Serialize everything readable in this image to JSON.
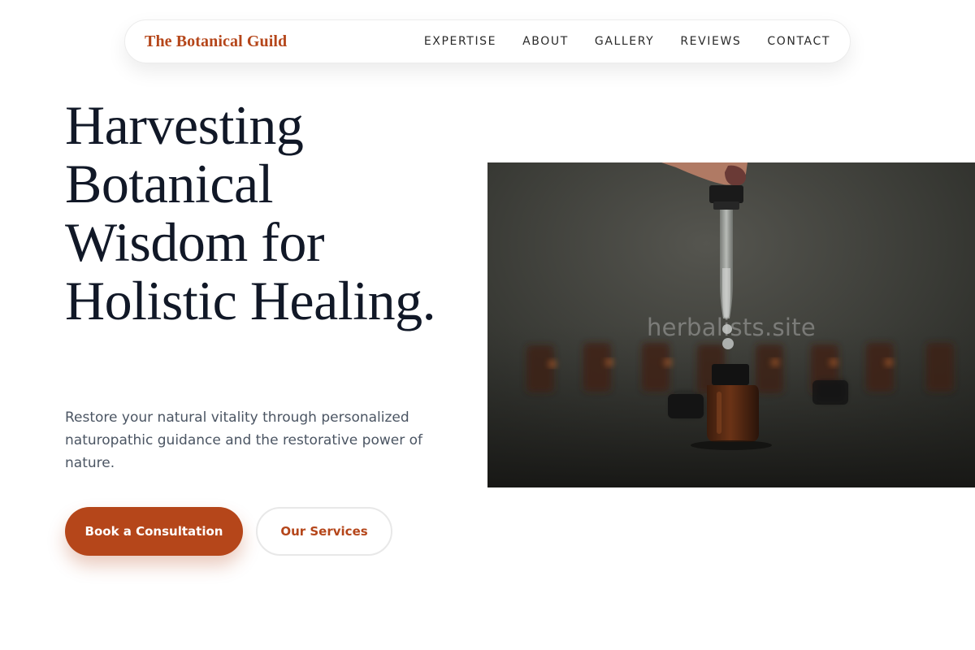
{
  "nav": {
    "brand": "The Botanical Guild",
    "links": [
      "EXPERTISE",
      "ABOUT",
      "GALLERY",
      "REVIEWS",
      "CONTACT"
    ]
  },
  "hero": {
    "headline": "Harvesting Botanical Wisdom for Holistic Healing.",
    "lede": "Restore your natural vitality through personalized naturopathic guidance and the restorative power of nature.",
    "primary_cta": "Book a Consultation",
    "secondary_cta": "Our Services",
    "image_watermark": "herbalists.site"
  },
  "colors": {
    "accent": "#b5461a",
    "heading": "#111827",
    "body_text": "#4b5563",
    "photo_background": "#2b2c28"
  },
  "icons": {
    "hero_image": "dropper-bottle-photo"
  }
}
